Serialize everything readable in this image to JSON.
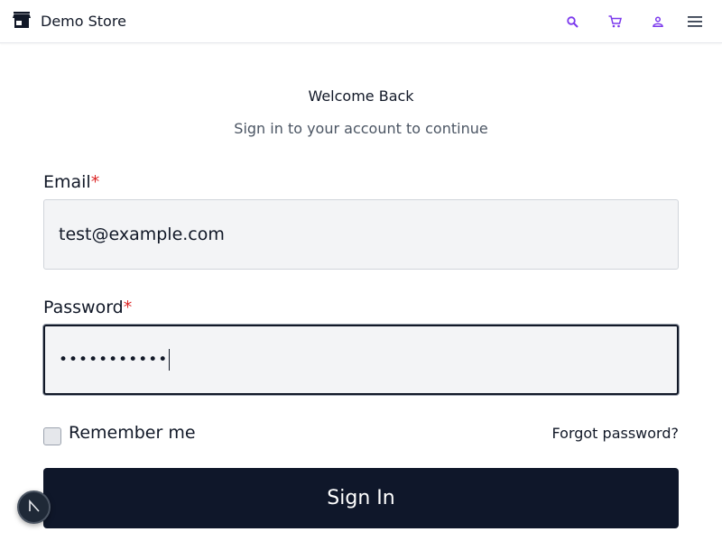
{
  "header": {
    "brand_name": "Demo Store",
    "icons": [
      "store-icon",
      "search-icon",
      "cart-icon",
      "user-icon",
      "menu-icon"
    ],
    "accent_color": "#7c3aed"
  },
  "login": {
    "title": "Welcome Back",
    "subtitle": "Sign in to your account to continue",
    "email": {
      "label": "Email",
      "required_mark": "*",
      "value": "test@example.com"
    },
    "password": {
      "label": "Password",
      "required_mark": "*",
      "masked_value": "•••••••••••"
    },
    "remember_label": "Remember me",
    "forgot_label": "Forgot password?",
    "submit_label": "Sign In"
  },
  "colors": {
    "button_bg": "#0f172a",
    "required": "#dc2626",
    "input_bg": "#f3f4f6"
  }
}
